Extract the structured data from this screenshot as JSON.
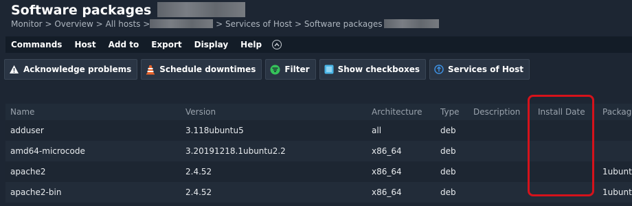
{
  "header": {
    "title": "Software packages",
    "breadcrumb": {
      "monitor": "Monitor",
      "overview": "Overview",
      "all_hosts": "All hosts",
      "services_of_host": "Services of Host",
      "software_packages": "Software packages",
      "separator": ">"
    }
  },
  "menu": {
    "items": [
      "Commands",
      "Host",
      "Add to",
      "Export",
      "Display",
      "Help"
    ],
    "toggle_icon": "chevron-up-icon"
  },
  "toolbar": {
    "acknowledge": "Acknowledge problems",
    "schedule": "Schedule downtimes",
    "filter": "Filter",
    "checkboxes": "Show checkboxes",
    "services": "Services of Host"
  },
  "table": {
    "columns": [
      "Name",
      "Version",
      "Architecture",
      "Type",
      "Description",
      "Install Date",
      "Packag"
    ],
    "rows": [
      {
        "name": "adduser",
        "version": "3.118ubuntu5",
        "arch": "all",
        "type": "deb",
        "description": "",
        "install_date": "",
        "package": ""
      },
      {
        "name": "amd64-microcode",
        "version": "3.20191218.1ubuntu2.2",
        "arch": "x86_64",
        "type": "deb",
        "description": "",
        "install_date": "",
        "package": ""
      },
      {
        "name": "apache2",
        "version": "2.4.52",
        "arch": "x86_64",
        "type": "deb",
        "description": "",
        "install_date": "",
        "package": "1ubuntu"
      },
      {
        "name": "apache2-bin",
        "version": "2.4.52",
        "arch": "x86_64",
        "type": "deb",
        "description": "",
        "install_date": "",
        "package": "1ubuntu"
      }
    ]
  },
  "colors": {
    "background": "#1d2633",
    "menubar": "#131c27",
    "highlight": "#d6121b",
    "filter_icon": "#35c35a",
    "checkbox_icon": "#4ab5e6",
    "services_icon": "#3d8fe0",
    "warning_icon": "#ffffff",
    "cone_icon": "#e8642c"
  }
}
